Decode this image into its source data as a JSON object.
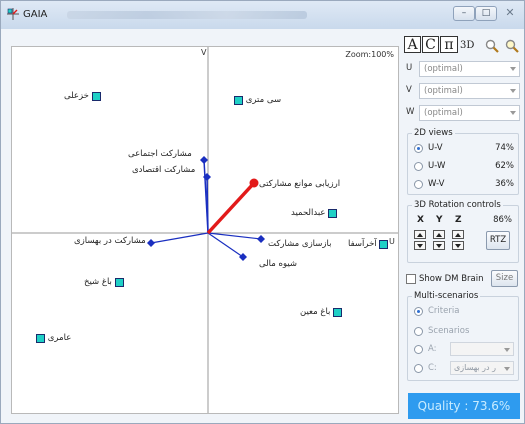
{
  "window": {
    "title": "GAIA",
    "minimize_symbol": "–",
    "maximize_symbol": "□",
    "close_symbol": "✕"
  },
  "plot": {
    "zoom_label": "Zoom:100%",
    "v_axis_label": "V",
    "u_axis_label": "U",
    "alternatives": [
      {
        "id": "a1",
        "label": "خزعلی"
      },
      {
        "id": "a2",
        "label": "سی متری"
      },
      {
        "id": "a3",
        "label": "عبدالحمید"
      },
      {
        "id": "a4",
        "label": "آخرآسفا"
      },
      {
        "id": "a5",
        "label": "باغ شیخ"
      },
      {
        "id": "a6",
        "label": "باغ معین"
      },
      {
        "id": "a7",
        "label": "عامری"
      }
    ],
    "criteria": [
      {
        "id": "c1",
        "label": "مشارکت اجتماعی"
      },
      {
        "id": "c2",
        "label": "مشارکت اقتصادی"
      },
      {
        "id": "c3",
        "label": "ارزیابی موانع مشارکتی"
      },
      {
        "id": "c4",
        "label": "بازسازی مشارکت"
      },
      {
        "id": "c5",
        "label": "شیوه مالی"
      },
      {
        "id": "c6",
        "label": "مشارکت در بهسازی"
      }
    ]
  },
  "panel": {
    "modes": {
      "a": "A",
      "c": "C",
      "pi": "π",
      "three_d": "3D"
    },
    "selectors": [
      {
        "axis": "U",
        "value": "(optimal)"
      },
      {
        "axis": "V",
        "value": "(optimal)"
      },
      {
        "axis": "W",
        "value": "(optimal)"
      }
    ],
    "views_2d": {
      "title": "2D views",
      "items": [
        {
          "label": "U-V",
          "pct": "74%",
          "selected": true
        },
        {
          "label": "U-W",
          "pct": "62%",
          "selected": false
        },
        {
          "label": "W-V",
          "pct": "36%",
          "selected": false
        }
      ]
    },
    "rotation": {
      "title": "3D Rotation controls",
      "x": "X",
      "y": "Y",
      "z": "Z",
      "pct": "86%",
      "rtz": "RTZ"
    },
    "show_dm_brain": "Show DM Brain",
    "size_btn": "Size",
    "multi": {
      "title": "Multi-scenarios",
      "criteria": "Criteria",
      "scenarios": "Scenarios",
      "a_label": "A:",
      "c_label": "C:",
      "c_value": "ر در بهسازی"
    },
    "quality": "Quality : 73.6%",
    "colors": {
      "alt_fill": "#1fd0c6",
      "crit": "#1a2fc0",
      "decision": "#e21a1a",
      "quality_bg": "#2e9bef"
    }
  }
}
